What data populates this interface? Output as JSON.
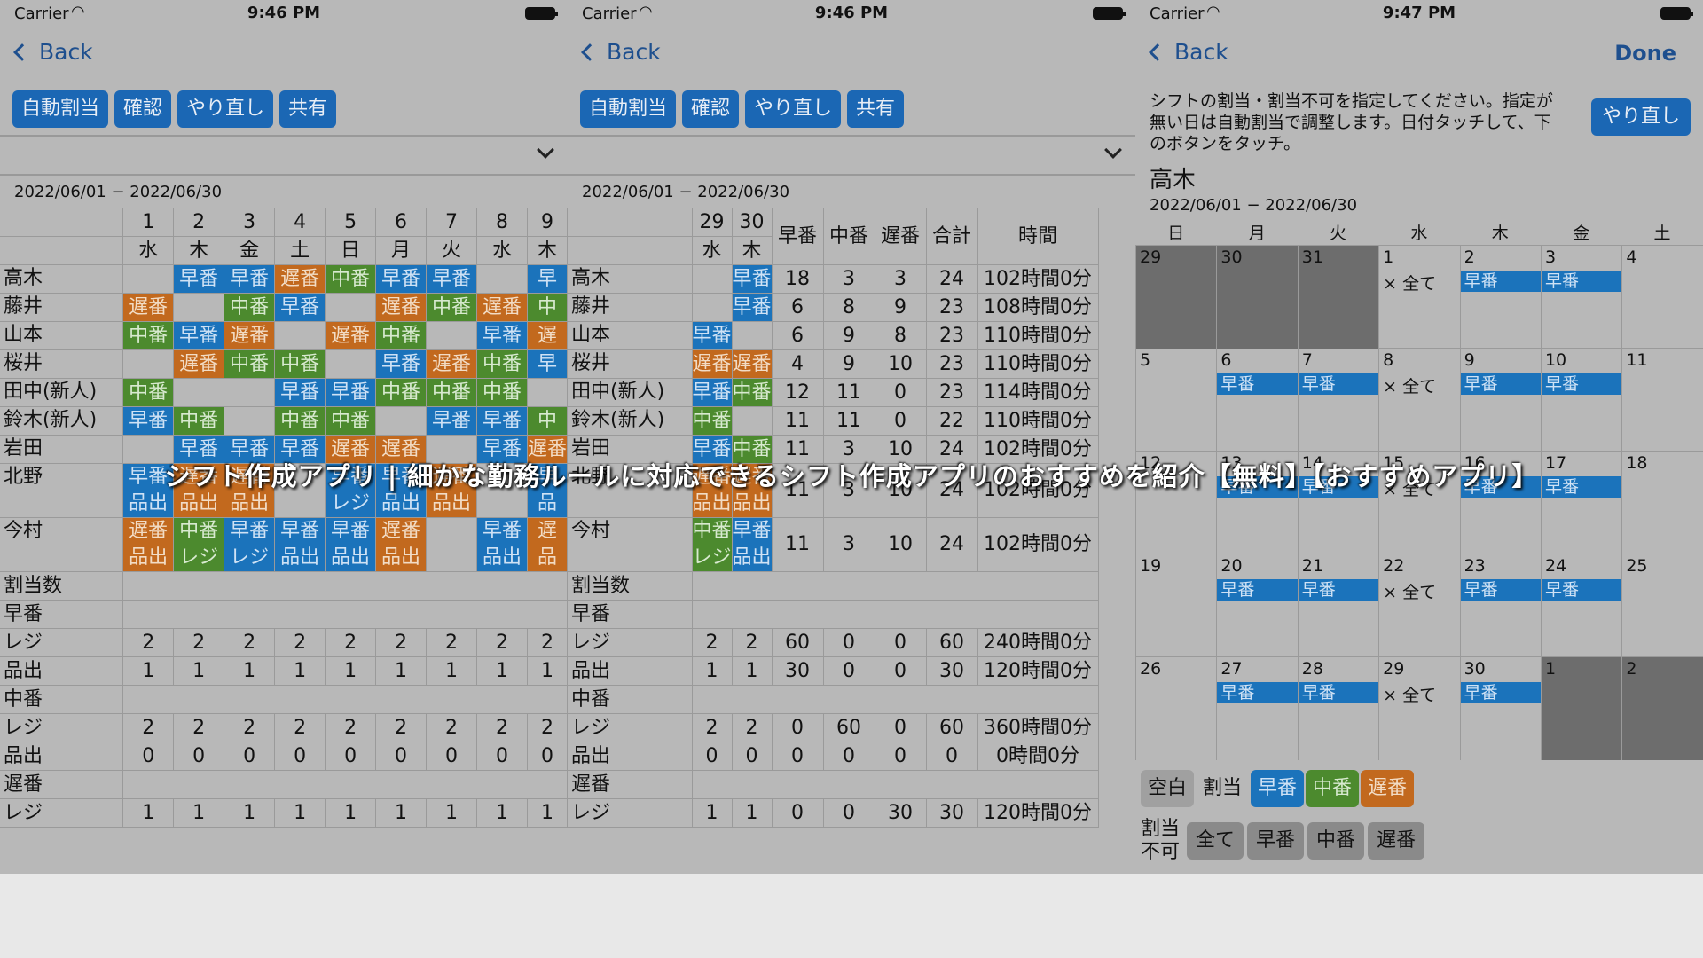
{
  "status": {
    "carrier": "Carrier",
    "time1": "9:46 PM",
    "time2": "9:46 PM",
    "time3": "9:47 PM"
  },
  "nav": {
    "back": "Back",
    "done": "Done"
  },
  "toolbar": {
    "auto": "自動割当",
    "confirm": "確認",
    "redo": "やり直し",
    "share": "共有"
  },
  "range": "2022/06/01 − 2022/06/30",
  "overlay": "シフト作成アプリ | 細かな勤務ルールに対応できるシフト作成アプリのおすすめを紹介【無料】【おすすめアプリ】",
  "colors": {
    "early": "#1b73bb",
    "mid": "#4c8a2e",
    "late": "#c2691e",
    "button": "#1b67b4"
  },
  "screen1": {
    "days": [
      "1",
      "2",
      "3",
      "4",
      "5",
      "6",
      "7",
      "8",
      "9"
    ],
    "weekdays": [
      "水",
      "木",
      "金",
      "土",
      "日",
      "月",
      "火",
      "水",
      "木"
    ],
    "rows": [
      {
        "name": "高木",
        "cells": [
          "",
          "早番",
          "早番",
          "遅番",
          "中番",
          "早番",
          "早番",
          "",
          "早"
        ]
      },
      {
        "name": "藤井",
        "cells": [
          "遅番",
          "",
          "中番",
          "早番",
          "",
          "遅番",
          "中番",
          "遅番",
          "中"
        ]
      },
      {
        "name": "山本",
        "cells": [
          "中番",
          "早番",
          "遅番",
          "",
          "遅番",
          "中番",
          "",
          "早番",
          "遅"
        ]
      },
      {
        "name": "桜井",
        "cells": [
          "",
          "遅番",
          "中番",
          "中番",
          "",
          "早番",
          "遅番",
          "中番",
          "早"
        ]
      },
      {
        "name": "田中(新人)",
        "cells": [
          "中番",
          "",
          "",
          "早番",
          "早番",
          "中番",
          "中番",
          "中番",
          ""
        ]
      },
      {
        "name": "鈴木(新人)",
        "cells": [
          "早番",
          "中番",
          "",
          "中番",
          "中番",
          "",
          "早番",
          "早番",
          "中"
        ]
      },
      {
        "name": "岩田",
        "cells": [
          "",
          "早番",
          "早番",
          "早番",
          "遅番",
          "遅番",
          "",
          "早番",
          "遅番"
        ]
      },
      {
        "name": "北野",
        "cells": [
          "早番",
          "遅番",
          "遅番",
          "",
          "早番",
          "早番",
          "遅番",
          "",
          "早"
        ],
        "sub": [
          "品出",
          "品出",
          "品出",
          "",
          "レジ",
          "品出",
          "品出",
          "",
          "品"
        ]
      },
      {
        "name": "今村",
        "cells": [
          "遅番",
          "中番",
          "早番",
          "早番",
          "早番",
          "遅番",
          "",
          "早番",
          "遅"
        ],
        "sub": [
          "品出",
          "レジ",
          "レジ",
          "品出",
          "品出",
          "品出",
          "",
          "品出",
          "品"
        ]
      }
    ],
    "summary": [
      {
        "name": "割当数",
        "vals": []
      },
      {
        "name": "早番",
        "vals": []
      },
      {
        "name": "レジ",
        "vals": [
          "2",
          "2",
          "2",
          "2",
          "2",
          "2",
          "2",
          "2",
          "2"
        ]
      },
      {
        "name": "品出",
        "vals": [
          "1",
          "1",
          "1",
          "1",
          "1",
          "1",
          "1",
          "1",
          "1"
        ]
      },
      {
        "name": "中番",
        "vals": []
      },
      {
        "name": "レジ",
        "vals": [
          "2",
          "2",
          "2",
          "2",
          "2",
          "2",
          "2",
          "2",
          "2"
        ]
      },
      {
        "name": "品出",
        "vals": [
          "0",
          "0",
          "0",
          "0",
          "0",
          "0",
          "0",
          "0",
          "0"
        ]
      },
      {
        "name": "遅番",
        "vals": []
      },
      {
        "name": "レジ",
        "vals": [
          "1",
          "1",
          "1",
          "1",
          "1",
          "1",
          "1",
          "1",
          "1"
        ]
      }
    ]
  },
  "screen2": {
    "days": [
      "29",
      "30"
    ],
    "weekdays": [
      "水",
      "木"
    ],
    "headers": [
      "早番",
      "中番",
      "遅番",
      "合計",
      "時間"
    ],
    "rows": [
      {
        "name": "高木",
        "cells": [
          "",
          "早番"
        ],
        "vals": [
          "18",
          "3",
          "3",
          "24",
          "102時間0分"
        ]
      },
      {
        "name": "藤井",
        "cells": [
          "",
          "早番"
        ],
        "vals": [
          "6",
          "8",
          "9",
          "23",
          "108時間0分"
        ]
      },
      {
        "name": "山本",
        "cells": [
          "早番",
          ""
        ],
        "vals": [
          "6",
          "9",
          "8",
          "23",
          "110時間0分"
        ]
      },
      {
        "name": "桜井",
        "cells": [
          "遅番",
          "遅番"
        ],
        "vals": [
          "4",
          "9",
          "10",
          "23",
          "110時間0分"
        ]
      },
      {
        "name": "田中(新人)",
        "cells": [
          "早番",
          "中番"
        ],
        "vals": [
          "12",
          "11",
          "0",
          "23",
          "114時間0分"
        ]
      },
      {
        "name": "鈴木(新人)",
        "cells": [
          "中番",
          ""
        ],
        "vals": [
          "11",
          "11",
          "0",
          "22",
          "110時間0分"
        ]
      },
      {
        "name": "岩田",
        "cells": [
          "早番",
          "中番"
        ],
        "vals": [
          "11",
          "3",
          "10",
          "24",
          "102時間0分"
        ]
      },
      {
        "name": "北野",
        "cells": [
          "遅番",
          "遅番"
        ],
        "sub": [
          "品出",
          "品出"
        ],
        "vals": [
          "11",
          "3",
          "10",
          "24",
          "102時間0分"
        ]
      },
      {
        "name": "今村",
        "cells": [
          "中番",
          "早番"
        ],
        "sub": [
          "レジ",
          "品出"
        ],
        "vals": [
          "11",
          "3",
          "10",
          "24",
          "102時間0分"
        ]
      }
    ],
    "summary": [
      {
        "name": "割当数",
        "vals": []
      },
      {
        "name": "早番",
        "vals": []
      },
      {
        "name": "レジ",
        "vals": [
          "2",
          "2",
          "60",
          "0",
          "0",
          "60",
          "240時間0分"
        ]
      },
      {
        "name": "品出",
        "vals": [
          "1",
          "1",
          "30",
          "0",
          "0",
          "30",
          "120時間0分"
        ]
      },
      {
        "name": "中番",
        "vals": []
      },
      {
        "name": "レジ",
        "vals": [
          "2",
          "2",
          "0",
          "60",
          "0",
          "60",
          "360時間0分"
        ]
      },
      {
        "name": "品出",
        "vals": [
          "0",
          "0",
          "0",
          "0",
          "0",
          "0",
          "0時間0分"
        ]
      },
      {
        "name": "遅番",
        "vals": []
      },
      {
        "name": "レジ",
        "vals": [
          "1",
          "1",
          "0",
          "0",
          "30",
          "30",
          "120時間0分"
        ]
      }
    ]
  },
  "screen3": {
    "instruction": "シフトの割当・割当不可を指定してください。指定が無い日は自動割当で調整します。日付タッチして、下のボタンをタッチ。",
    "redo": "やり直し",
    "person": "高木",
    "weekdays": [
      "日",
      "月",
      "火",
      "水",
      "木",
      "金",
      "土"
    ],
    "weeks": [
      [
        {
          "d": "29",
          "dim": true
        },
        {
          "d": "30",
          "dim": true
        },
        {
          "d": "31",
          "dim": true
        },
        {
          "d": "1",
          "x": "× 全て"
        },
        {
          "d": "2",
          "tag": "早番"
        },
        {
          "d": "3",
          "tag": "早番"
        },
        {
          "d": "4"
        }
      ],
      [
        {
          "d": "5"
        },
        {
          "d": "6",
          "tag": "早番"
        },
        {
          "d": "7",
          "tag": "早番"
        },
        {
          "d": "8",
          "x": "× 全て"
        },
        {
          "d": "9",
          "tag": "早番"
        },
        {
          "d": "10",
          "tag": "早番"
        },
        {
          "d": "11"
        }
      ],
      [
        {
          "d": "12"
        },
        {
          "d": "13",
          "tag": "早番"
        },
        {
          "d": "14",
          "tag": "早番"
        },
        {
          "d": "15",
          "x": "× 全て"
        },
        {
          "d": "16",
          "tag": "早番"
        },
        {
          "d": "17",
          "tag": "早番"
        },
        {
          "d": "18"
        }
      ],
      [
        {
          "d": "19"
        },
        {
          "d": "20",
          "tag": "早番"
        },
        {
          "d": "21",
          "tag": "早番"
        },
        {
          "d": "22",
          "x": "× 全て"
        },
        {
          "d": "23",
          "tag": "早番"
        },
        {
          "d": "24",
          "tag": "早番"
        },
        {
          "d": "25"
        }
      ],
      [
        {
          "d": "26"
        },
        {
          "d": "27",
          "tag": "早番"
        },
        {
          "d": "28",
          "tag": "早番"
        },
        {
          "d": "29",
          "x": "× 全て"
        },
        {
          "d": "30",
          "tag": "早番"
        },
        {
          "d": "1",
          "dim": true
        },
        {
          "d": "2",
          "dim": true
        }
      ]
    ],
    "assign": {
      "blank": "空白",
      "label": "割当",
      "early": "早番",
      "mid": "中番",
      "late": "遅番"
    },
    "forbid": {
      "label1": "割当",
      "label2": "不可",
      "all": "全て",
      "early": "早番",
      "mid": "中番",
      "late": "遅番"
    }
  }
}
